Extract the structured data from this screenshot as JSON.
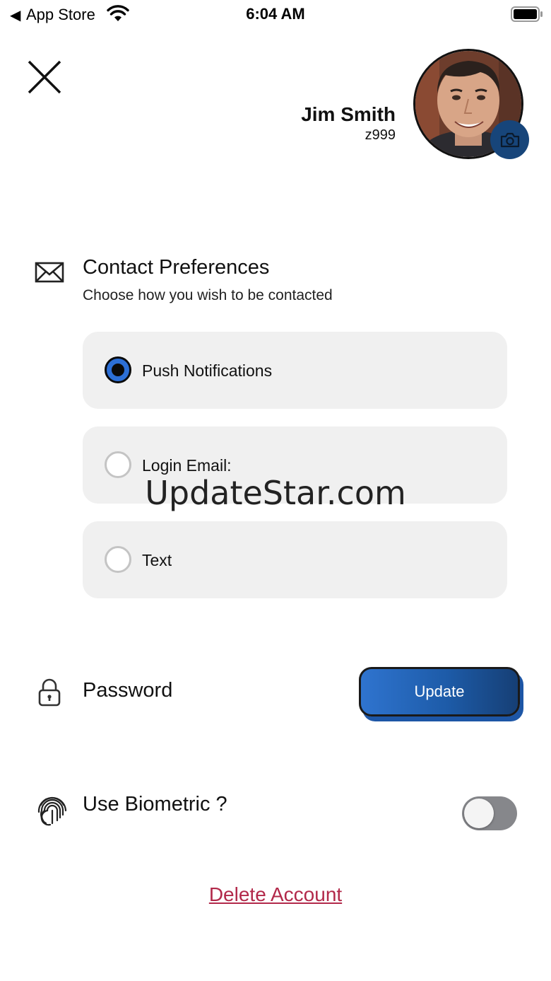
{
  "status_bar": {
    "back_glyph": "◀",
    "app": "App Store",
    "time": "6:04 AM"
  },
  "header": {
    "close_icon": "close-icon",
    "name": "Jim Smith",
    "id": "z999",
    "camera_icon": "camera-icon"
  },
  "contact": {
    "title": "Contact Preferences",
    "subtitle": "Choose how you wish to be contacted",
    "options": [
      {
        "label": "Push Notifications",
        "selected": true
      },
      {
        "label": "Login Email:",
        "selected": false
      },
      {
        "label": "Text",
        "selected": false
      }
    ]
  },
  "watermark": "UpdateStar.com",
  "password": {
    "label": "Password",
    "button": "Update"
  },
  "biometric": {
    "label": "Use Biometric ?",
    "enabled": false
  },
  "delete_label": "Delete Account",
  "colors": {
    "accent": "#2c6fd6",
    "camera_bg": "#17457a",
    "delete": "#b2294a",
    "card_bg": "#f0f0f0"
  }
}
